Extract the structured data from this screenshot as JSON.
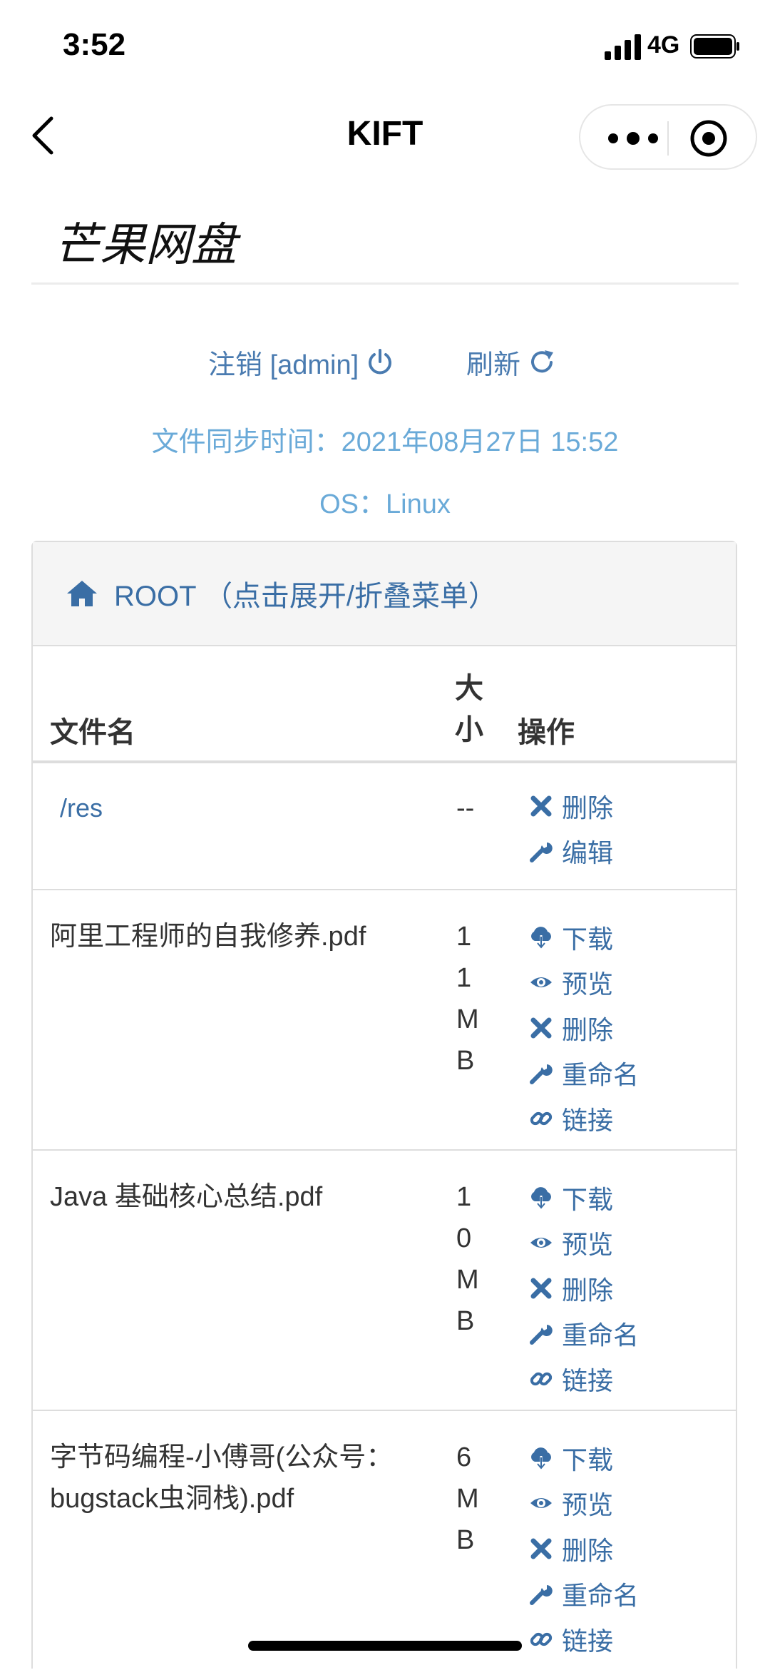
{
  "status_bar": {
    "time": "3:52",
    "network": "4G"
  },
  "nav": {
    "title": "KIFT"
  },
  "brand": {
    "title": "芒果网盘"
  },
  "actions": {
    "logout": "注销 [admin]",
    "refresh": "刷新"
  },
  "info": {
    "sync_time": "文件同步时间：2021年08月27日 15:52",
    "os": "OS：Linux"
  },
  "panel": {
    "root_label": "ROOT （点击展开/折叠菜单）"
  },
  "table": {
    "headers": {
      "name": "文件名",
      "size_1": "大",
      "size_2": "小",
      "ops": "操作"
    },
    "rows": [
      {
        "name": "/res",
        "size": "--",
        "ops": [
          "删除",
          "编辑"
        ]
      },
      {
        "name": "阿里工程师的自我修养.pdf",
        "size": [
          "1",
          "1",
          "M",
          "B"
        ],
        "ops": [
          "下载",
          "预览",
          "删除",
          "重命名",
          "链接"
        ]
      },
      {
        "name": "Java 基础核心总结.pdf",
        "size": [
          "1",
          "0",
          "M",
          "B"
        ],
        "ops": [
          "下载",
          "预览",
          "删除",
          "重命名",
          "链接"
        ]
      },
      {
        "name_1": "字节码编程-小傅哥(公众号：",
        "name_2": "bugstack虫洞栈).pdf",
        "size": [
          "6",
          "M",
          "B"
        ],
        "ops": [
          "下载",
          "预览",
          "删除",
          "重命名",
          "链接"
        ]
      }
    ]
  },
  "colors": {
    "link": "#3a6ea5",
    "info": "#6aaad8",
    "border": "#dddddd"
  },
  "icons": [
    "back-icon",
    "more-icon",
    "close-miniprogram-icon",
    "power-icon",
    "refresh-icon",
    "home-icon",
    "delete-icon",
    "edit-icon",
    "download-icon",
    "preview-icon",
    "link-icon"
  ]
}
